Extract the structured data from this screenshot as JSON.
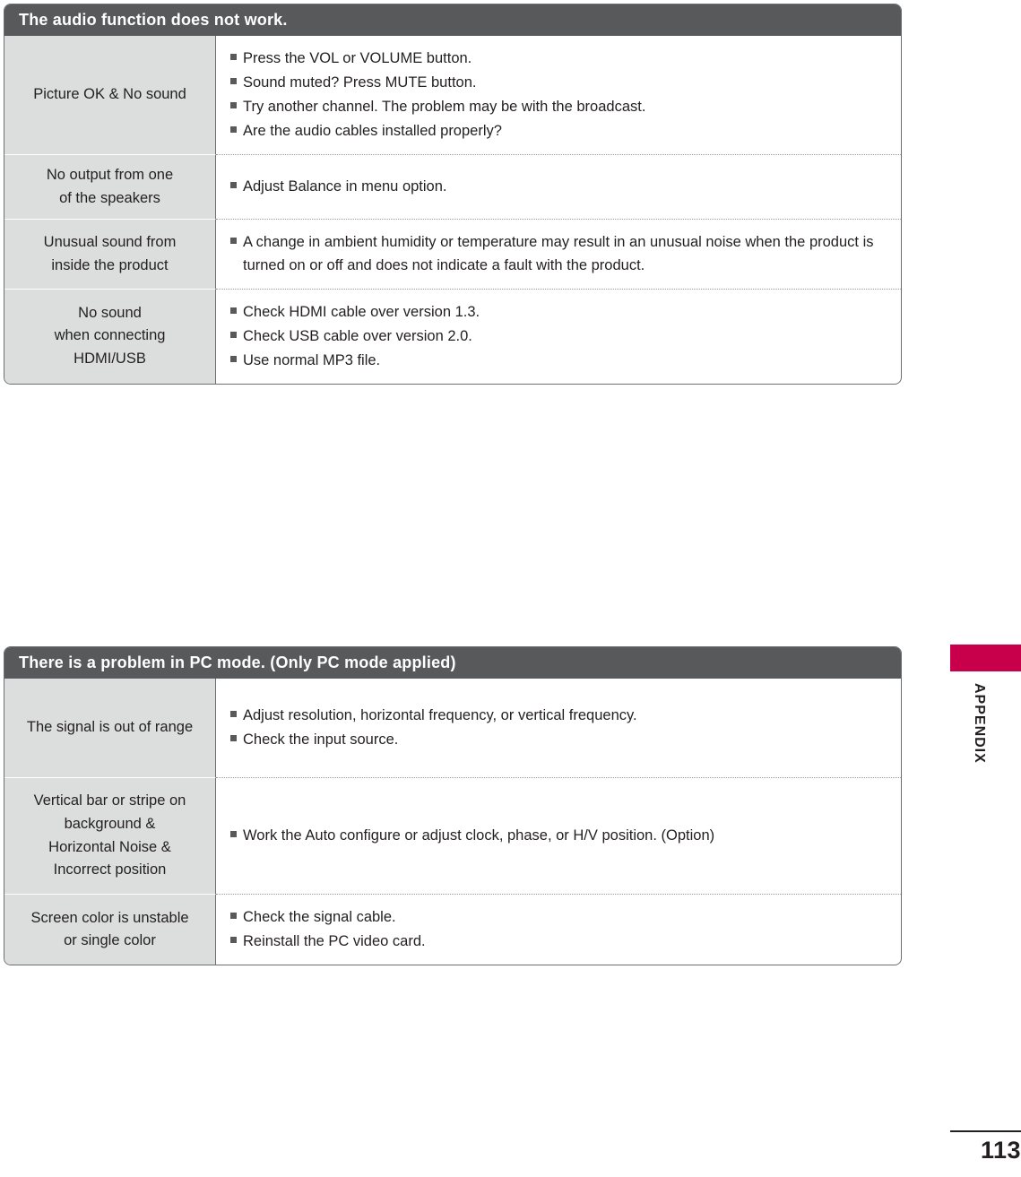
{
  "page": {
    "number": "113",
    "side_label": "APPENDIX",
    "accent_color": "#c8004b",
    "header_bg": "#58595b",
    "left_cell_bg": "#dcdddd"
  },
  "tables": [
    {
      "id": "audio",
      "title": "The audio function does not work.",
      "rows": [
        {
          "label": "Picture OK & No sound",
          "items": [
            "Press the VOL or VOLUME button.",
            "Sound muted? Press MUTE button.",
            "Try another channel. The problem may be with the broadcast.",
            "Are the audio cables installed properly?"
          ]
        },
        {
          "label": "No output from one\nof the speakers",
          "items": [
            "Adjust Balance in menu option."
          ]
        },
        {
          "label": "Unusual sound from\ninside the product",
          "items": [
            "A change in ambient humidity or temperature may result in an unusual noise when the product is turned on or off and does not indicate a fault with the product."
          ]
        },
        {
          "label": "No sound\nwhen connecting\nHDMI/USB",
          "items": [
            "Check HDMI cable over version 1.3.",
            "Check USB cable over version 2.0.",
            "Use normal MP3 file."
          ]
        }
      ]
    },
    {
      "id": "pc",
      "title": "There is a problem in PC mode. (Only PC mode applied)",
      "rows": [
        {
          "label": "The signal is out of range",
          "items": [
            "Adjust resolution, horizontal frequency, or vertical frequency.",
            "Check the input source."
          ]
        },
        {
          "label": "Vertical bar or stripe on\nbackground &\nHorizontal Noise &\nIncorrect position",
          "items": [
            "Work the Auto configure or adjust clock, phase, or H/V position. (Option)"
          ]
        },
        {
          "label": "Screen color is unstable\nor single color",
          "items": [
            "Check the signal cable.",
            "Reinstall the PC video card."
          ]
        }
      ]
    }
  ]
}
